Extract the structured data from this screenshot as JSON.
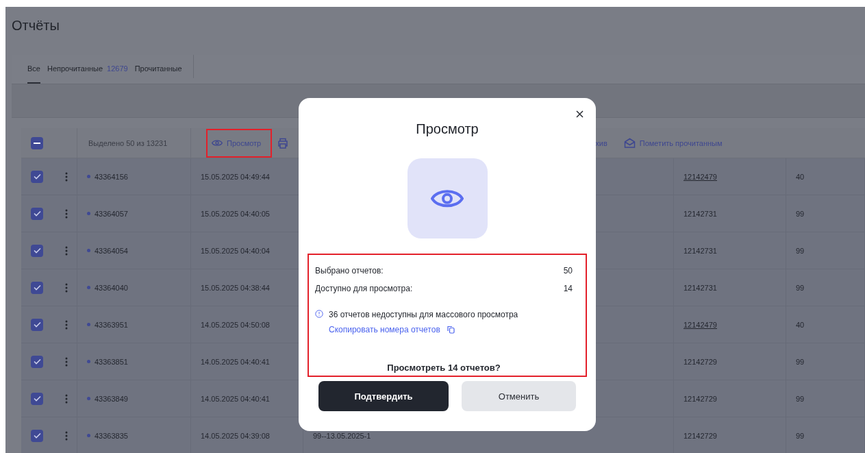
{
  "page": {
    "title": "Отчёты"
  },
  "tabs": [
    {
      "label": "Все",
      "selected": true
    },
    {
      "label": "Непрочитанные",
      "count": "12679",
      "selected": false
    },
    {
      "label": "Прочитанные",
      "selected": false
    }
  ],
  "table": {
    "select_all": {
      "indeterminate": true
    },
    "selection_text": "Выделено 50 из 13231",
    "actions": [
      {
        "kind": "view",
        "label": "Просмотр",
        "highlighted": true
      },
      {
        "kind": "print",
        "highlighted": false
      },
      {
        "kind": "archive",
        "label": "хив",
        "highlighted": false
      },
      {
        "kind": "mark_read",
        "label": "Пометить прочитанным",
        "highlighted": false
      }
    ],
    "rows": [
      {
        "checked": true,
        "unread": true,
        "id": "43364156",
        "date": "15.05.2025 04:49:44",
        "reference": "12142479",
        "linked": true,
        "column_6": "40"
      },
      {
        "checked": true,
        "unread": true,
        "id": "43364057",
        "date": "15.05.2025 04:40:05",
        "reference": "12142731",
        "linked": false,
        "column_6": "99"
      },
      {
        "checked": true,
        "unread": true,
        "id": "43364054",
        "date": "15.05.2025 04:40:04",
        "reference": "12142731",
        "linked": false,
        "column_6": "99"
      },
      {
        "checked": true,
        "unread": true,
        "id": "43364040",
        "date": "15.05.2025 04:38:44",
        "reference": "12142731",
        "linked": false,
        "column_6": "99"
      },
      {
        "checked": true,
        "unread": true,
        "id": "43363951",
        "date": "14.05.2025 04:50:08",
        "reference": "12142479",
        "linked": true,
        "column_6": "40"
      },
      {
        "checked": true,
        "unread": true,
        "id": "43363851",
        "date": "14.05.2025 04:40:41",
        "reference": "12142729",
        "linked": false,
        "column_6": "99"
      },
      {
        "checked": true,
        "unread": true,
        "id": "43363849",
        "date": "14.05.2025 04:40:41",
        "reference": "12142729",
        "linked": false,
        "column_6": "99"
      },
      {
        "checked": true,
        "unread": true,
        "id": "43363835",
        "date": "14.05.2025 04:39:08",
        "column_3": "99--13.05.2025-1",
        "reference": "12142729",
        "linked": false,
        "column_6": "99"
      }
    ]
  },
  "dialog": {
    "title": "Просмотр",
    "summary_highlighted": true,
    "stats": [
      {
        "label": "Выбрано отчетов:",
        "value": "50"
      },
      {
        "label": "Доступно для просмотра:",
        "value": "14"
      }
    ],
    "notice": "36 отчетов недоступны для массового просмотра",
    "copy_link": "Скопировать номера отчетов",
    "question": "Просмотреть 14 отчетов?",
    "buttons": [
      {
        "kind": "primary",
        "label": "Подтвердить"
      },
      {
        "kind": "secondary",
        "label": "Отменить"
      }
    ]
  }
}
